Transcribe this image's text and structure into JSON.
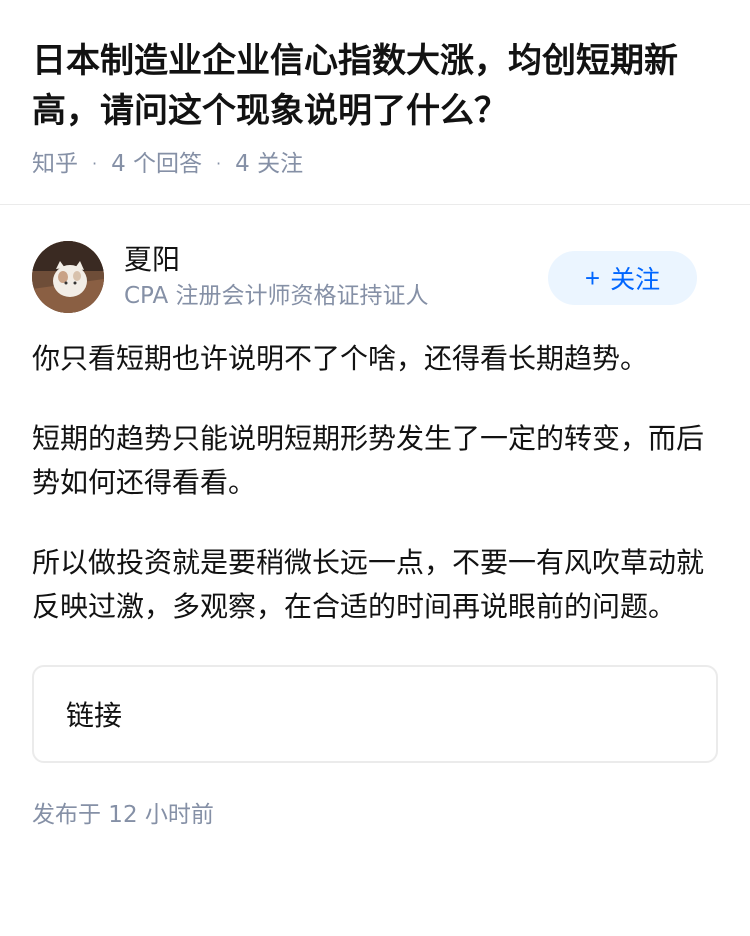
{
  "question": {
    "title": "日本制造业企业信心指数大涨，均创短期新高，请问这个现象说明了什么？",
    "source": "知乎",
    "answer_count": "4 个回答",
    "follower_count": "4 关注"
  },
  "answer": {
    "author": {
      "name": "夏阳",
      "headline": "CPA 注册会计师资格证持证人"
    },
    "follow_button": {
      "plus": "+",
      "label": "关注"
    },
    "paragraphs": [
      "你只看短期也许说明不了个啥，还得看长期趋势。",
      "短期的趋势只能说明短期形势发生了一定的转变，而后势如何还得看看。",
      "所以做投资就是要稍微长远一点，不要一有风吹草动就反映过激，多观察，在合适的时间再说眼前的问题。"
    ],
    "link_card_label": "链接",
    "publish_time": "发布于  12 小时前"
  },
  "colors": {
    "meta_gray": "#8590a6",
    "follow_blue": "#0066ff",
    "follow_bg": "#ebf5ff",
    "divider": "#ebebeb"
  }
}
